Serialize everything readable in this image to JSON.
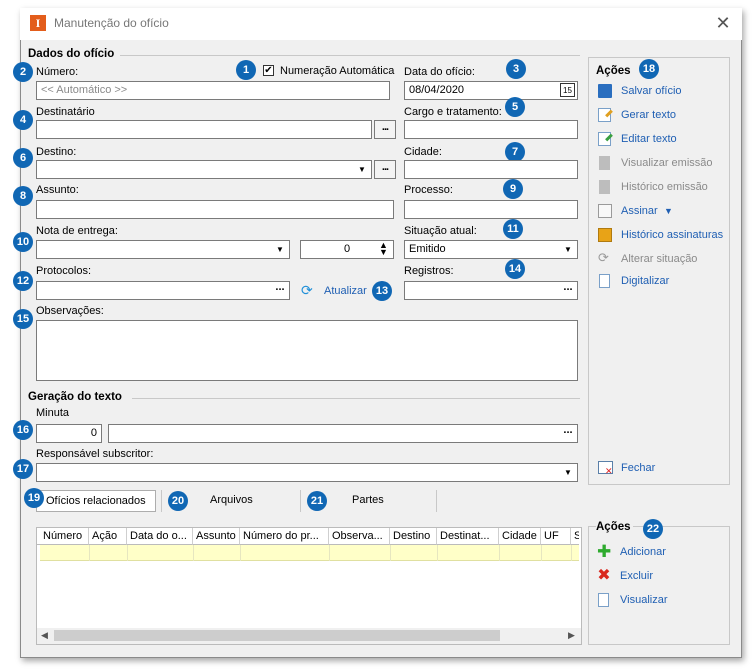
{
  "window": {
    "title": "Manutenção do ofício",
    "close_glyph": "✕"
  },
  "dados": {
    "section_title": "Dados do ofício",
    "numero_label": "Número:",
    "numero_placeholder": "<< Automático >>",
    "numeracao_automatica_label": "Numeração Automática",
    "numeracao_automatica_checked": true,
    "data_label": "Data do ofício:",
    "data_value": "08/04/2020",
    "destinatario_label": "Destinatário",
    "cargo_label": "Cargo e tratamento:",
    "destino_label": "Destino:",
    "cidade_label": "Cidade:",
    "assunto_label": "Assunto:",
    "processo_label": "Processo:",
    "nota_label": "Nota de entrega:",
    "nota_numero": "0",
    "situacao_label": "Situação atual:",
    "situacao_value": "Emitido",
    "protocolos_label": "Protocolos:",
    "atualizar_label": "Atualizar",
    "registros_label": "Registros:",
    "observacoes_label": "Observações:",
    "ellipsis": "..."
  },
  "geracao": {
    "section_title": "Geração do texto",
    "minuta_label": "Minuta",
    "minuta_value": "0",
    "responsavel_label": "Responsável subscritor:"
  },
  "acoes_top": {
    "title": "Ações",
    "items": [
      {
        "label": "Salvar ofício",
        "icon": "save-icon",
        "enabled": true
      },
      {
        "label": "Gerar texto",
        "icon": "edit-document-icon",
        "enabled": true
      },
      {
        "label": "Editar texto",
        "icon": "edit-text-icon",
        "enabled": true
      },
      {
        "label": "Visualizar emissão",
        "icon": "document-icon",
        "enabled": false
      },
      {
        "label": "Histórico emissão",
        "icon": "history-icon",
        "enabled": false
      },
      {
        "label": "Assinar",
        "icon": "sign-icon",
        "enabled": true
      },
      {
        "label": "Histórico assinaturas",
        "icon": "signature-history-icon",
        "enabled": true
      },
      {
        "label": "Alterar situação",
        "icon": "refresh-icon",
        "enabled": false
      },
      {
        "label": "Digitalizar",
        "icon": "scan-icon",
        "enabled": true
      }
    ],
    "fechar_label": "Fechar"
  },
  "tabs": [
    {
      "label": "Ofícios relacionados",
      "active": true
    },
    {
      "label": "Arquivos",
      "active": false
    },
    {
      "label": "Partes",
      "active": false
    }
  ],
  "table": {
    "columns": [
      "Número",
      "Ação",
      "Data do o...",
      "Assunto",
      "Número do pr...",
      "Observa...",
      "Destino",
      "Destinat...",
      "Cidade",
      "UF",
      "S"
    ]
  },
  "acoes_bottom": {
    "title": "Ações",
    "items": [
      {
        "label": "Adicionar",
        "icon": "add-icon"
      },
      {
        "label": "Excluir",
        "icon": "delete-icon"
      },
      {
        "label": "Visualizar",
        "icon": "view-icon"
      }
    ]
  },
  "badges": [
    "1",
    "2",
    "3",
    "4",
    "5",
    "6",
    "7",
    "8",
    "9",
    "10",
    "11",
    "12",
    "13",
    "14",
    "15",
    "16",
    "17",
    "18",
    "19",
    "20",
    "21",
    "22"
  ],
  "colors": {
    "accent": "#1067b4",
    "link": "#1f5fb3",
    "selected_row": "#ffffc8"
  }
}
